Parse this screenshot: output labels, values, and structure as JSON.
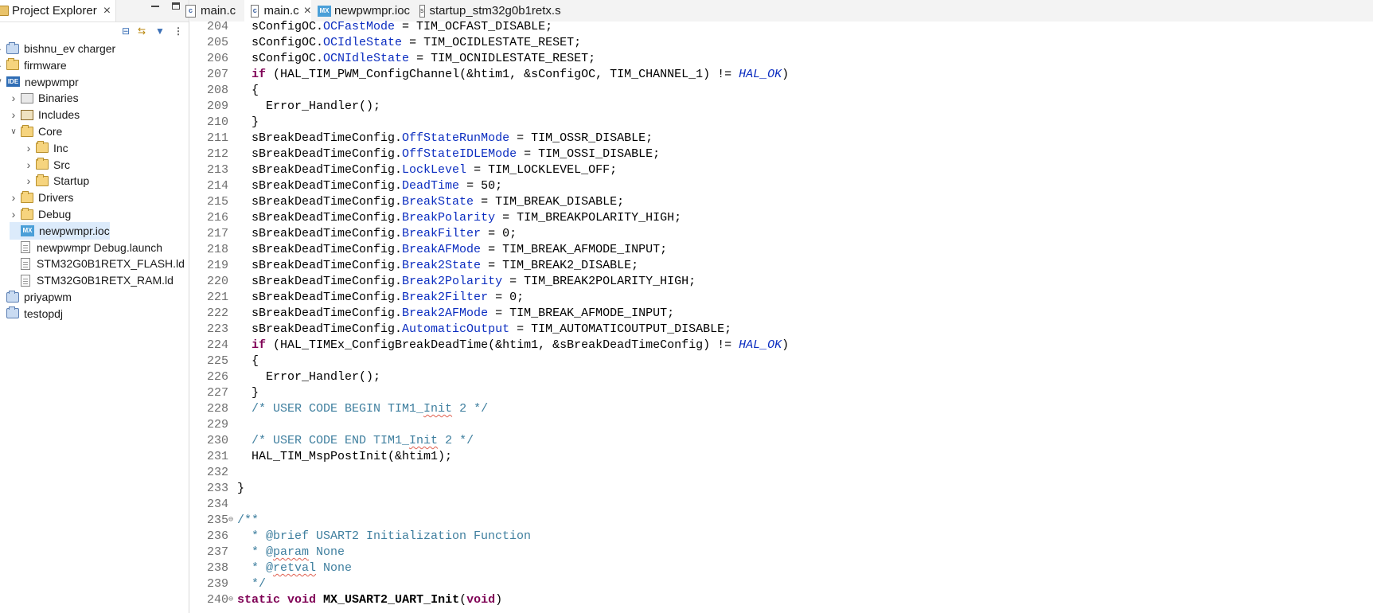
{
  "project_explorer": {
    "title": "Project Explorer",
    "close": "×",
    "tree": [
      {
        "label": "bishnu_ev charger",
        "icon": "project-icon",
        "level": 0,
        "expanded": false
      },
      {
        "label": "firmware",
        "icon": "folder-icon",
        "level": 0,
        "expanded": false
      },
      {
        "label": "newpwmpr",
        "icon": "ide-project-icon",
        "level": 0,
        "expanded": true
      },
      {
        "label": "Binaries",
        "icon": "binaries-icon",
        "level": 1,
        "expanded": false
      },
      {
        "label": "Includes",
        "icon": "includes-icon",
        "level": 1,
        "expanded": false
      },
      {
        "label": "Core",
        "icon": "folder-icon",
        "level": 1,
        "expanded": true
      },
      {
        "label": "Inc",
        "icon": "folder-icon",
        "level": 2,
        "expanded": false
      },
      {
        "label": "Src",
        "icon": "folder-icon",
        "level": 2,
        "expanded": false
      },
      {
        "label": "Startup",
        "icon": "folder-icon",
        "level": 2,
        "expanded": false
      },
      {
        "label": "Drivers",
        "icon": "folder-icon",
        "level": 1,
        "expanded": false
      },
      {
        "label": "Debug",
        "icon": "folder-icon",
        "level": 1,
        "expanded": false
      },
      {
        "label": "newpwmpr.ioc",
        "icon": "mx-file-icon",
        "level": 1,
        "selected": true
      },
      {
        "label": "newpwmpr Debug.launch",
        "icon": "file-icon",
        "level": 1
      },
      {
        "label": "STM32G0B1RETX_FLASH.ld",
        "icon": "file-icon",
        "level": 1
      },
      {
        "label": "STM32G0B1RETX_RAM.ld",
        "icon": "file-icon",
        "level": 1
      },
      {
        "label": "priyapwm",
        "icon": "project-icon",
        "level": 0
      },
      {
        "label": "testopdj",
        "icon": "project-icon",
        "level": 0
      }
    ]
  },
  "editor_tabs": [
    {
      "label": "main.c",
      "icon": "c-file-icon",
      "active": false
    },
    {
      "label": "main.c",
      "icon": "c-file-icon",
      "active": true,
      "close": "×"
    },
    {
      "label": "newpwmpr.ioc",
      "icon": "mx-file-icon",
      "active": false
    },
    {
      "label": "startup_stm32g0b1retx.s",
      "icon": "asm-file-icon",
      "active": false
    }
  ],
  "code_lines": [
    {
      "n": "204",
      "t": [
        [
          "  sConfigOC.",
          ""
        ],
        [
          "OCFastMode",
          "f"
        ],
        [
          " = TIM_OCFAST_DISABLE;",
          ""
        ]
      ]
    },
    {
      "n": "205",
      "t": [
        [
          "  sConfigOC.",
          ""
        ],
        [
          "OCIdleState",
          "f"
        ],
        [
          " = TIM_OCIDLESTATE_RESET;",
          ""
        ]
      ]
    },
    {
      "n": "206",
      "t": [
        [
          "  sConfigOC.",
          ""
        ],
        [
          "OCNIdleState",
          "f"
        ],
        [
          " = TIM_OCNIDLESTATE_RESET;",
          ""
        ]
      ]
    },
    {
      "n": "207",
      "t": [
        [
          "  ",
          ""
        ],
        [
          "if",
          "kw"
        ],
        [
          " (HAL_TIM_PWM_ConfigChannel(&htim1, &sConfigOC, TIM_CHANNEL_1) != ",
          ""
        ],
        [
          "HAL_OK",
          "it"
        ],
        [
          ")",
          ""
        ]
      ]
    },
    {
      "n": "208",
      "t": [
        [
          "  {",
          ""
        ]
      ]
    },
    {
      "n": "209",
      "t": [
        [
          "    Error_Handler();",
          ""
        ]
      ]
    },
    {
      "n": "210",
      "t": [
        [
          "  }",
          ""
        ]
      ]
    },
    {
      "n": "211",
      "t": [
        [
          "  sBreakDeadTimeConfig.",
          ""
        ],
        [
          "OffStateRunMode",
          "f"
        ],
        [
          " = TIM_OSSR_DISABLE;",
          ""
        ]
      ]
    },
    {
      "n": "212",
      "t": [
        [
          "  sBreakDeadTimeConfig.",
          ""
        ],
        [
          "OffStateIDLEMode",
          "f"
        ],
        [
          " = TIM_OSSI_DISABLE;",
          ""
        ]
      ]
    },
    {
      "n": "213",
      "t": [
        [
          "  sBreakDeadTimeConfig.",
          ""
        ],
        [
          "LockLevel",
          "f"
        ],
        [
          " = TIM_LOCKLEVEL_OFF;",
          ""
        ]
      ]
    },
    {
      "n": "214",
      "t": [
        [
          "  sBreakDeadTimeConfig.",
          ""
        ],
        [
          "DeadTime",
          "f"
        ],
        [
          " = 50;",
          ""
        ]
      ]
    },
    {
      "n": "215",
      "t": [
        [
          "  sBreakDeadTimeConfig.",
          ""
        ],
        [
          "BreakState",
          "f"
        ],
        [
          " = TIM_BREAK_DISABLE;",
          ""
        ]
      ]
    },
    {
      "n": "216",
      "t": [
        [
          "  sBreakDeadTimeConfig.",
          ""
        ],
        [
          "BreakPolarity",
          "f"
        ],
        [
          " = TIM_BREAKPOLARITY_HIGH;",
          ""
        ]
      ]
    },
    {
      "n": "217",
      "t": [
        [
          "  sBreakDeadTimeConfig.",
          ""
        ],
        [
          "BreakFilter",
          "f"
        ],
        [
          " = 0;",
          ""
        ]
      ]
    },
    {
      "n": "218",
      "t": [
        [
          "  sBreakDeadTimeConfig.",
          ""
        ],
        [
          "BreakAFMode",
          "f"
        ],
        [
          " = TIM_BREAK_AFMODE_INPUT;",
          ""
        ]
      ]
    },
    {
      "n": "219",
      "t": [
        [
          "  sBreakDeadTimeConfig.",
          ""
        ],
        [
          "Break2State",
          "f"
        ],
        [
          " = TIM_BREAK2_DISABLE;",
          ""
        ]
      ]
    },
    {
      "n": "220",
      "t": [
        [
          "  sBreakDeadTimeConfig.",
          ""
        ],
        [
          "Break2Polarity",
          "f"
        ],
        [
          " = TIM_BREAK2POLARITY_HIGH;",
          ""
        ]
      ]
    },
    {
      "n": "221",
      "t": [
        [
          "  sBreakDeadTimeConfig.",
          ""
        ],
        [
          "Break2Filter",
          "f"
        ],
        [
          " = 0;",
          ""
        ]
      ]
    },
    {
      "n": "222",
      "t": [
        [
          "  sBreakDeadTimeConfig.",
          ""
        ],
        [
          "Break2AFMode",
          "f"
        ],
        [
          " = TIM_BREAK_AFMODE_INPUT;",
          ""
        ]
      ]
    },
    {
      "n": "223",
      "t": [
        [
          "  sBreakDeadTimeConfig.",
          ""
        ],
        [
          "AutomaticOutput",
          "f"
        ],
        [
          " = TIM_AUTOMATICOUTPUT_DISABLE;",
          ""
        ]
      ]
    },
    {
      "n": "224",
      "t": [
        [
          "  ",
          ""
        ],
        [
          "if",
          "kw"
        ],
        [
          " (HAL_TIMEx_ConfigBreakDeadTime(&htim1, &sBreakDeadTimeConfig) != ",
          ""
        ],
        [
          "HAL_OK",
          "it"
        ],
        [
          ")",
          ""
        ]
      ]
    },
    {
      "n": "225",
      "t": [
        [
          "  {",
          ""
        ]
      ]
    },
    {
      "n": "226",
      "t": [
        [
          "    Error_Handler();",
          ""
        ]
      ]
    },
    {
      "n": "227",
      "t": [
        [
          "  }",
          ""
        ]
      ]
    },
    {
      "n": "228",
      "t": [
        [
          "  /* USER CODE BEGIN TIM1_",
          "cm"
        ],
        [
          "Init",
          "cm sq"
        ],
        [
          " 2 */",
          "cm"
        ]
      ]
    },
    {
      "n": "229",
      "t": [
        [
          "",
          ""
        ]
      ]
    },
    {
      "n": "230",
      "t": [
        [
          "  /* USER CODE END TIM1_",
          "cm"
        ],
        [
          "Init",
          "cm sq"
        ],
        [
          " 2 */",
          "cm"
        ]
      ]
    },
    {
      "n": "231",
      "t": [
        [
          "  HAL_TIM_MspPostInit(&htim1);",
          ""
        ]
      ]
    },
    {
      "n": "232",
      "t": [
        [
          "",
          ""
        ]
      ]
    },
    {
      "n": "233",
      "t": [
        [
          "}",
          ""
        ]
      ]
    },
    {
      "n": "234",
      "t": [
        [
          "",
          ""
        ]
      ]
    },
    {
      "n": "235",
      "fold": "⊖",
      "t": [
        [
          "/**",
          "cm"
        ]
      ]
    },
    {
      "n": "236",
      "t": [
        [
          "  * @brief USART2 Initialization Function",
          "cm"
        ]
      ]
    },
    {
      "n": "237",
      "t": [
        [
          "  * @",
          "cm"
        ],
        [
          "param",
          "cm sq"
        ],
        [
          " None",
          "cm"
        ]
      ]
    },
    {
      "n": "238",
      "t": [
        [
          "  * @",
          "cm"
        ],
        [
          "retval",
          "cm sq"
        ],
        [
          " None",
          "cm"
        ]
      ]
    },
    {
      "n": "239",
      "t": [
        [
          "  */",
          "cm"
        ]
      ]
    },
    {
      "n": "240",
      "fold": "⊖",
      "t": [
        [
          "static void",
          "kw"
        ],
        [
          " ",
          ""
        ],
        [
          "MX_USART2_UART_Init",
          "fn"
        ],
        [
          "(",
          ""
        ],
        [
          "void",
          "kw"
        ],
        [
          ")",
          ""
        ]
      ]
    }
  ],
  "colors": {
    "keyword": "#7f0055",
    "field": "#0b2dc0",
    "comment": "#3f7f9f",
    "line_number": "#6f6f6f",
    "selection": "#dcebfb"
  }
}
